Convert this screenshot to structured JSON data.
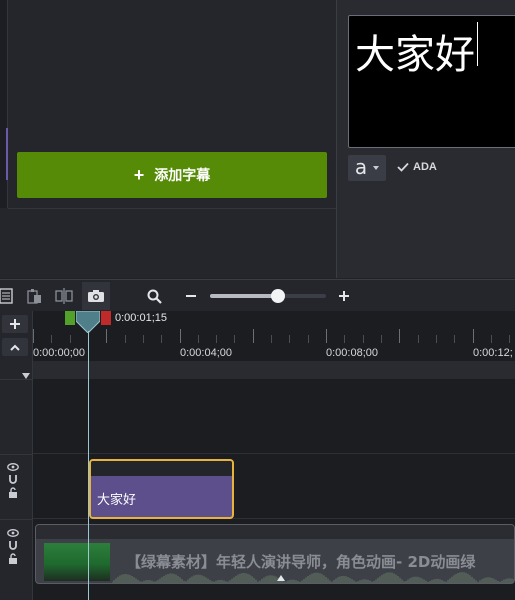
{
  "captions_panel": {
    "add_caption_label": "添加字幕"
  },
  "caption_editor": {
    "preview_text": "大家好",
    "font_button_glyph": "a",
    "ada_label": "ADA"
  },
  "timeline": {
    "zoom_level_fraction": 0.59,
    "playhead_time": "0:00:01;15",
    "ruler_labels": [
      "0:00:00;00",
      "0:00:04;00",
      "0:00:08;00",
      "0:00:12;"
    ],
    "caption_clip_text": "大家好",
    "media_clip_title": "【绿幕素材】年轻人演讲导师，角色动画- 2D动画绿"
  },
  "colors": {
    "add_button": "#558b06",
    "caption_clip": "#5d4f8c",
    "selection_border": "#e8b33b",
    "in_point": "#52a12a",
    "out_point": "#c12a2a"
  }
}
